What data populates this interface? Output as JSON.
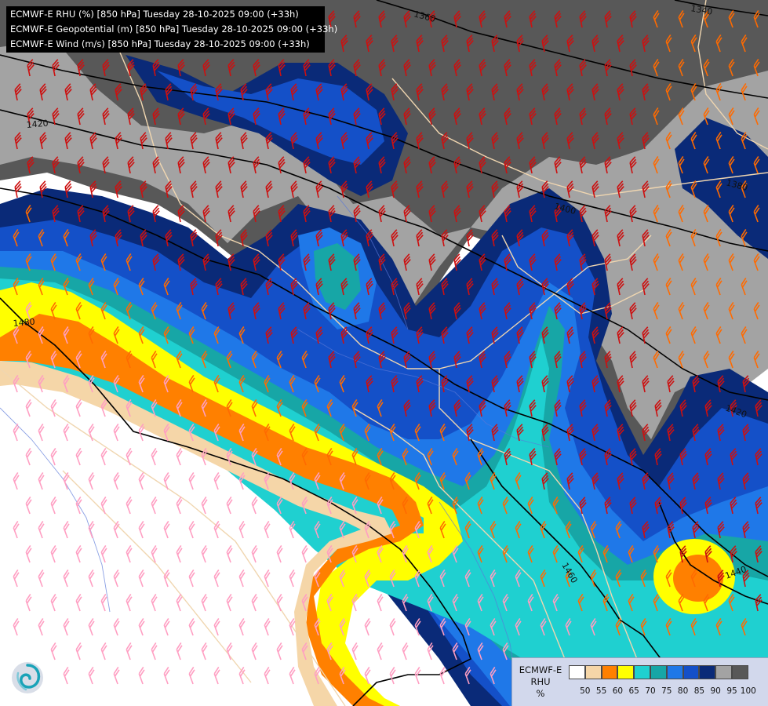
{
  "title_lines": [
    "ECMWF-E RHU (%) [850 hPa] Tuesday 28-10-2025 09:00 (+33h)",
    "ECMWF-E Geopotential (m) [850 hPa] Tuesday 28-10-2025 09:00 (+33h)",
    "ECMWF-E Wind (m/s) [850 hPa] Tuesday 28-10-2025 09:00 (+33h)"
  ],
  "legend": {
    "model": "ECMWF-E",
    "variable": "RHU",
    "unit": "%",
    "colors": [
      "#ffffff",
      "#f5d6a8",
      "#ff8000",
      "#ffff00",
      "#1fd0d0",
      "#17a6a6",
      "#1f78e8",
      "#1450c8",
      "#0a2a78",
      "#a3a3a3",
      "#585858"
    ],
    "ticks": [
      "50",
      "55",
      "60",
      "65",
      "70",
      "75",
      "80",
      "85",
      "90",
      "95",
      "100"
    ]
  },
  "contour_labels": [
    "1340",
    "1360",
    "1380",
    "1400",
    "1420",
    "1420",
    "1440",
    "1460",
    "1480"
  ],
  "logo_icon": "ecmwf-swirl-icon"
}
